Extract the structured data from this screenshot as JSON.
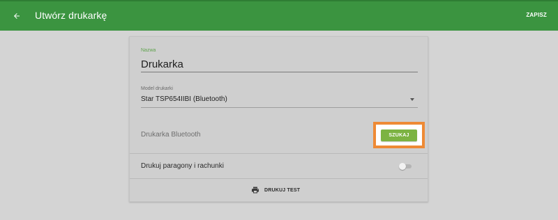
{
  "appbar": {
    "title": "Utwórz drukarkę",
    "save_label": "ZAPISZ",
    "back_icon": "arrow-left-icon",
    "color": "#3b9440"
  },
  "form": {
    "name_label": "Nazwa",
    "name_value": "Drukarka",
    "model_label": "Model drukarki",
    "model_value": "Star TSP654IIBI (Bluetooth)",
    "bluetooth_label": "Drukarka Bluetooth",
    "search_label": "SZUKAJ",
    "print_receipts_label": "Drukuj paragony i rachunki",
    "print_receipts_enabled": false,
    "test_print_label": "DRUKUJ TEST",
    "test_print_icon": "printer-icon",
    "accent_color": "#7cb342",
    "highlight_color": "#ee8a35"
  }
}
